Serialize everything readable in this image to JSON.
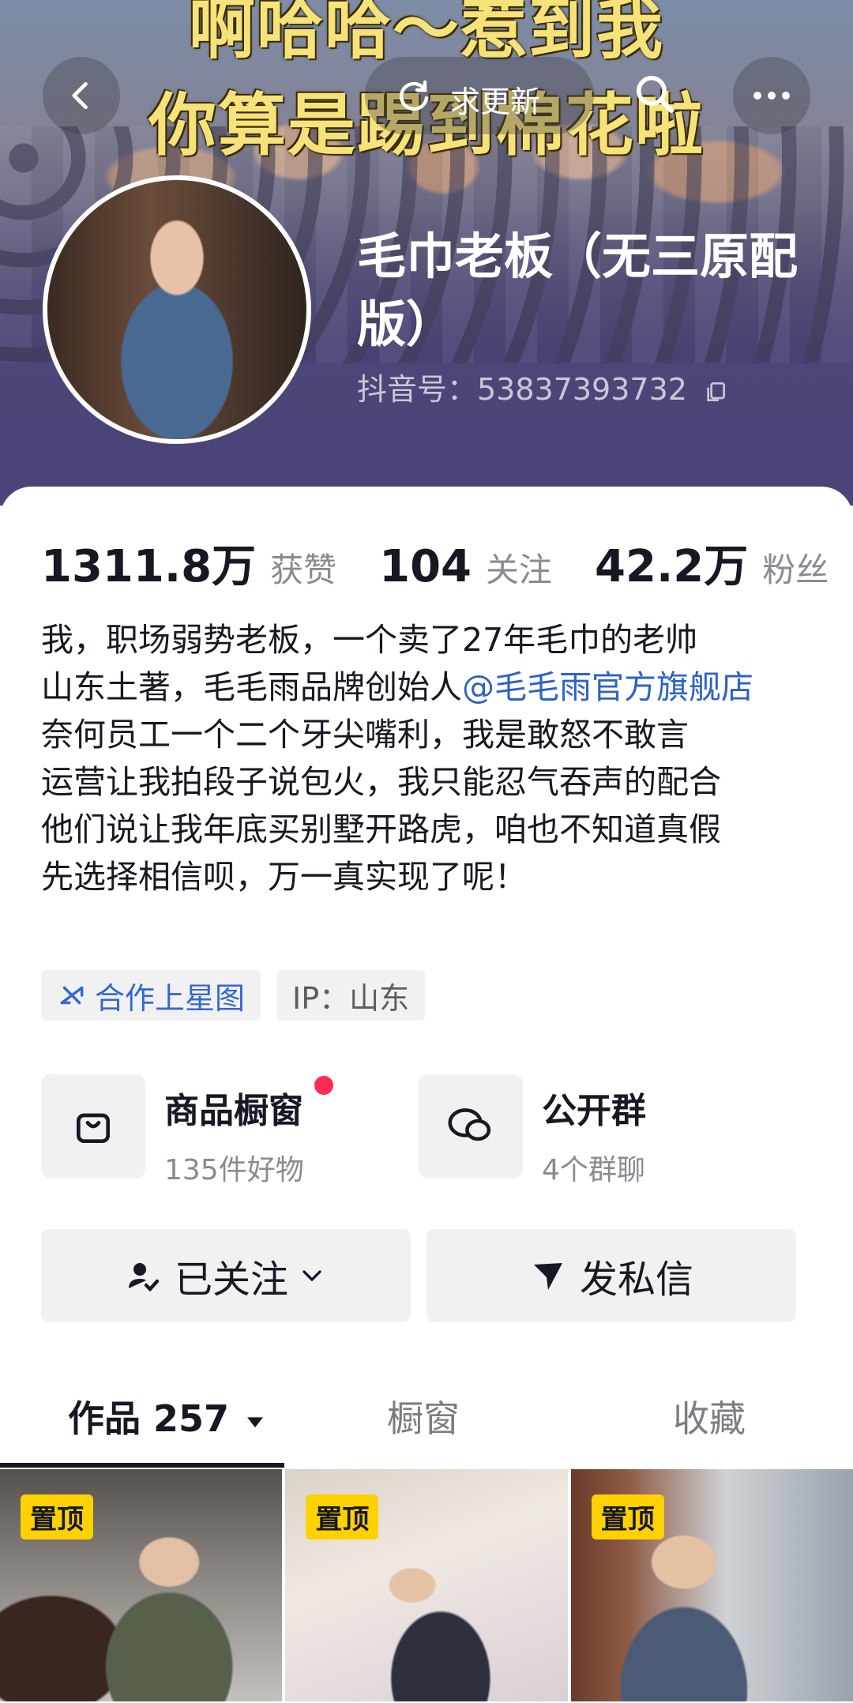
{
  "banner": {
    "headline_line1": "啊哈哈～惹到我",
    "headline_line2": "你算是踢到棉花啦",
    "update_label": "求更新"
  },
  "profile": {
    "nickname": "毛巾老板（无三原配版）",
    "douyin_id": "抖音号：53837393732"
  },
  "stats": [
    {
      "value": "1311.8万",
      "label": "获赞"
    },
    {
      "value": "104",
      "label": "关注"
    },
    {
      "value": "42.2万",
      "label": "粉丝"
    }
  ],
  "bio": {
    "line1": "我，职场弱势老板，一个卖了27年毛巾的老帅",
    "line2_prefix": "山东土著，毛毛雨品牌创始人",
    "mention": "@毛毛雨官方旗舰店",
    "line4": "奈何员工一个二个牙尖嘴利，我是敢怒不敢言",
    "line5": "运营让我拍段子说包火，我只能忍气吞声的配合",
    "line6": "他们说让我年底买别墅开路虎，咱也不知道真假",
    "line7": "先选择相信呗，万一真实现了呢！"
  },
  "tags": {
    "star": "合作上星图",
    "ip": "IP：山东"
  },
  "entries": {
    "shop_title": "商品橱窗",
    "shop_sub": "135件好物",
    "group_title": "公开群",
    "group_sub": "4个群聊"
  },
  "actions": {
    "follow": "已关注",
    "message": "发私信"
  },
  "tabs": {
    "works": "作品 257",
    "shop": "橱窗",
    "favorites": "收藏"
  },
  "grid": {
    "pin_label": "置顶"
  },
  "colors": {
    "accent_link": "#2e62c6",
    "notify_dot": "#fe2c55",
    "pin_badge": "#ffd100",
    "banner_text": "#f6e27a"
  }
}
